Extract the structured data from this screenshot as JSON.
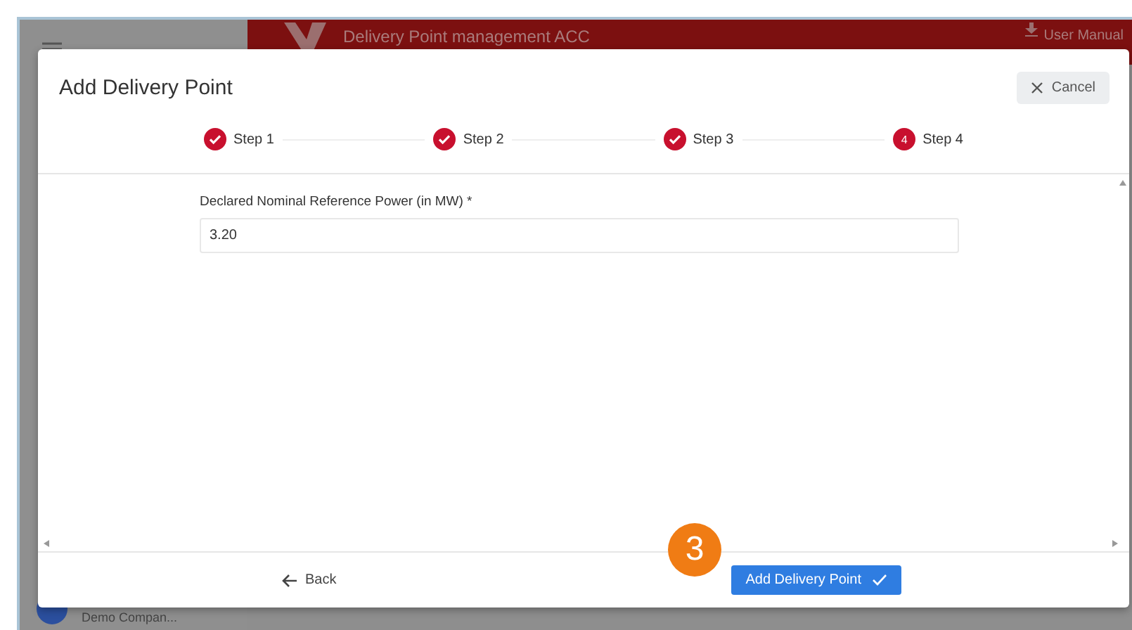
{
  "app_header": {
    "title": "Delivery Point management ACC",
    "user_manual": "User Manual"
  },
  "sidebar": {
    "company": "Demo Compan..."
  },
  "dialog": {
    "title": "Add Delivery Point",
    "cancel": "Cancel",
    "steps": [
      {
        "label": "Step 1",
        "completed": true
      },
      {
        "label": "Step 2",
        "completed": true
      },
      {
        "label": "Step 3",
        "completed": true
      },
      {
        "label": "Step 4",
        "completed": false,
        "number": "4"
      }
    ],
    "field": {
      "label": "Declared Nominal Reference Power (in MW) *",
      "value": "3.20"
    },
    "back": "Back",
    "submit": "Add Delivery Point"
  },
  "annotation": {
    "badge": "3"
  }
}
